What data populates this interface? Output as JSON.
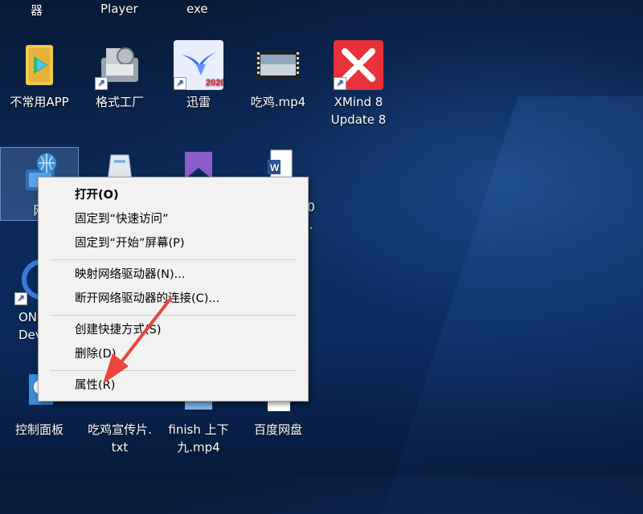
{
  "desktop": {
    "top_labels": [
      "器",
      "Player",
      "exe"
    ],
    "icons": [
      {
        "label": "不常用APP",
        "icon": "folder-video-icon"
      },
      {
        "label": "格式工厂",
        "icon": "format-factory-icon"
      },
      {
        "label": "迅雷",
        "icon": "xunlei-icon",
        "badge": "2020"
      },
      {
        "label": "吃鸡.mp4",
        "icon": "video-file-icon"
      },
      {
        "label": "XMind 8\nUpdate 8",
        "icon": "xmind-icon"
      },
      {
        "label": "网",
        "icon": "network-icon"
      },
      {
        "label": "ON\nDevi",
        "icon": "onedrive-icon"
      },
      {
        "label": "控制面板",
        "icon": "control-panel-icon"
      },
      {
        "label": "吃鸡宣传片.\ntxt",
        "icon": "text-file-icon"
      },
      {
        "label": "finish 上下\n九.mp4",
        "icon": "video-file-icon"
      },
      {
        "label": "百度网盘",
        "icon": "baidu-netdisk-icon"
      },
      {
        "label": "0\n.",
        "icon": "word-doc-icon"
      }
    ]
  },
  "context_menu": {
    "items": [
      {
        "label": "打开(O)",
        "bold": true
      },
      {
        "label": "固定到“快速访问”"
      },
      {
        "label": "固定到“开始”屏幕(P)"
      },
      {
        "label": "映射网络驱动器(N)..."
      },
      {
        "label": "断开网络驱动器的连接(C)..."
      },
      {
        "label": "创建快捷方式(S)"
      },
      {
        "label": "删除(D)"
      },
      {
        "label": "属性(R)"
      }
    ]
  },
  "colors": {
    "accent_arrow": "#e8463c",
    "menu_bg": "#f2f2f2"
  }
}
